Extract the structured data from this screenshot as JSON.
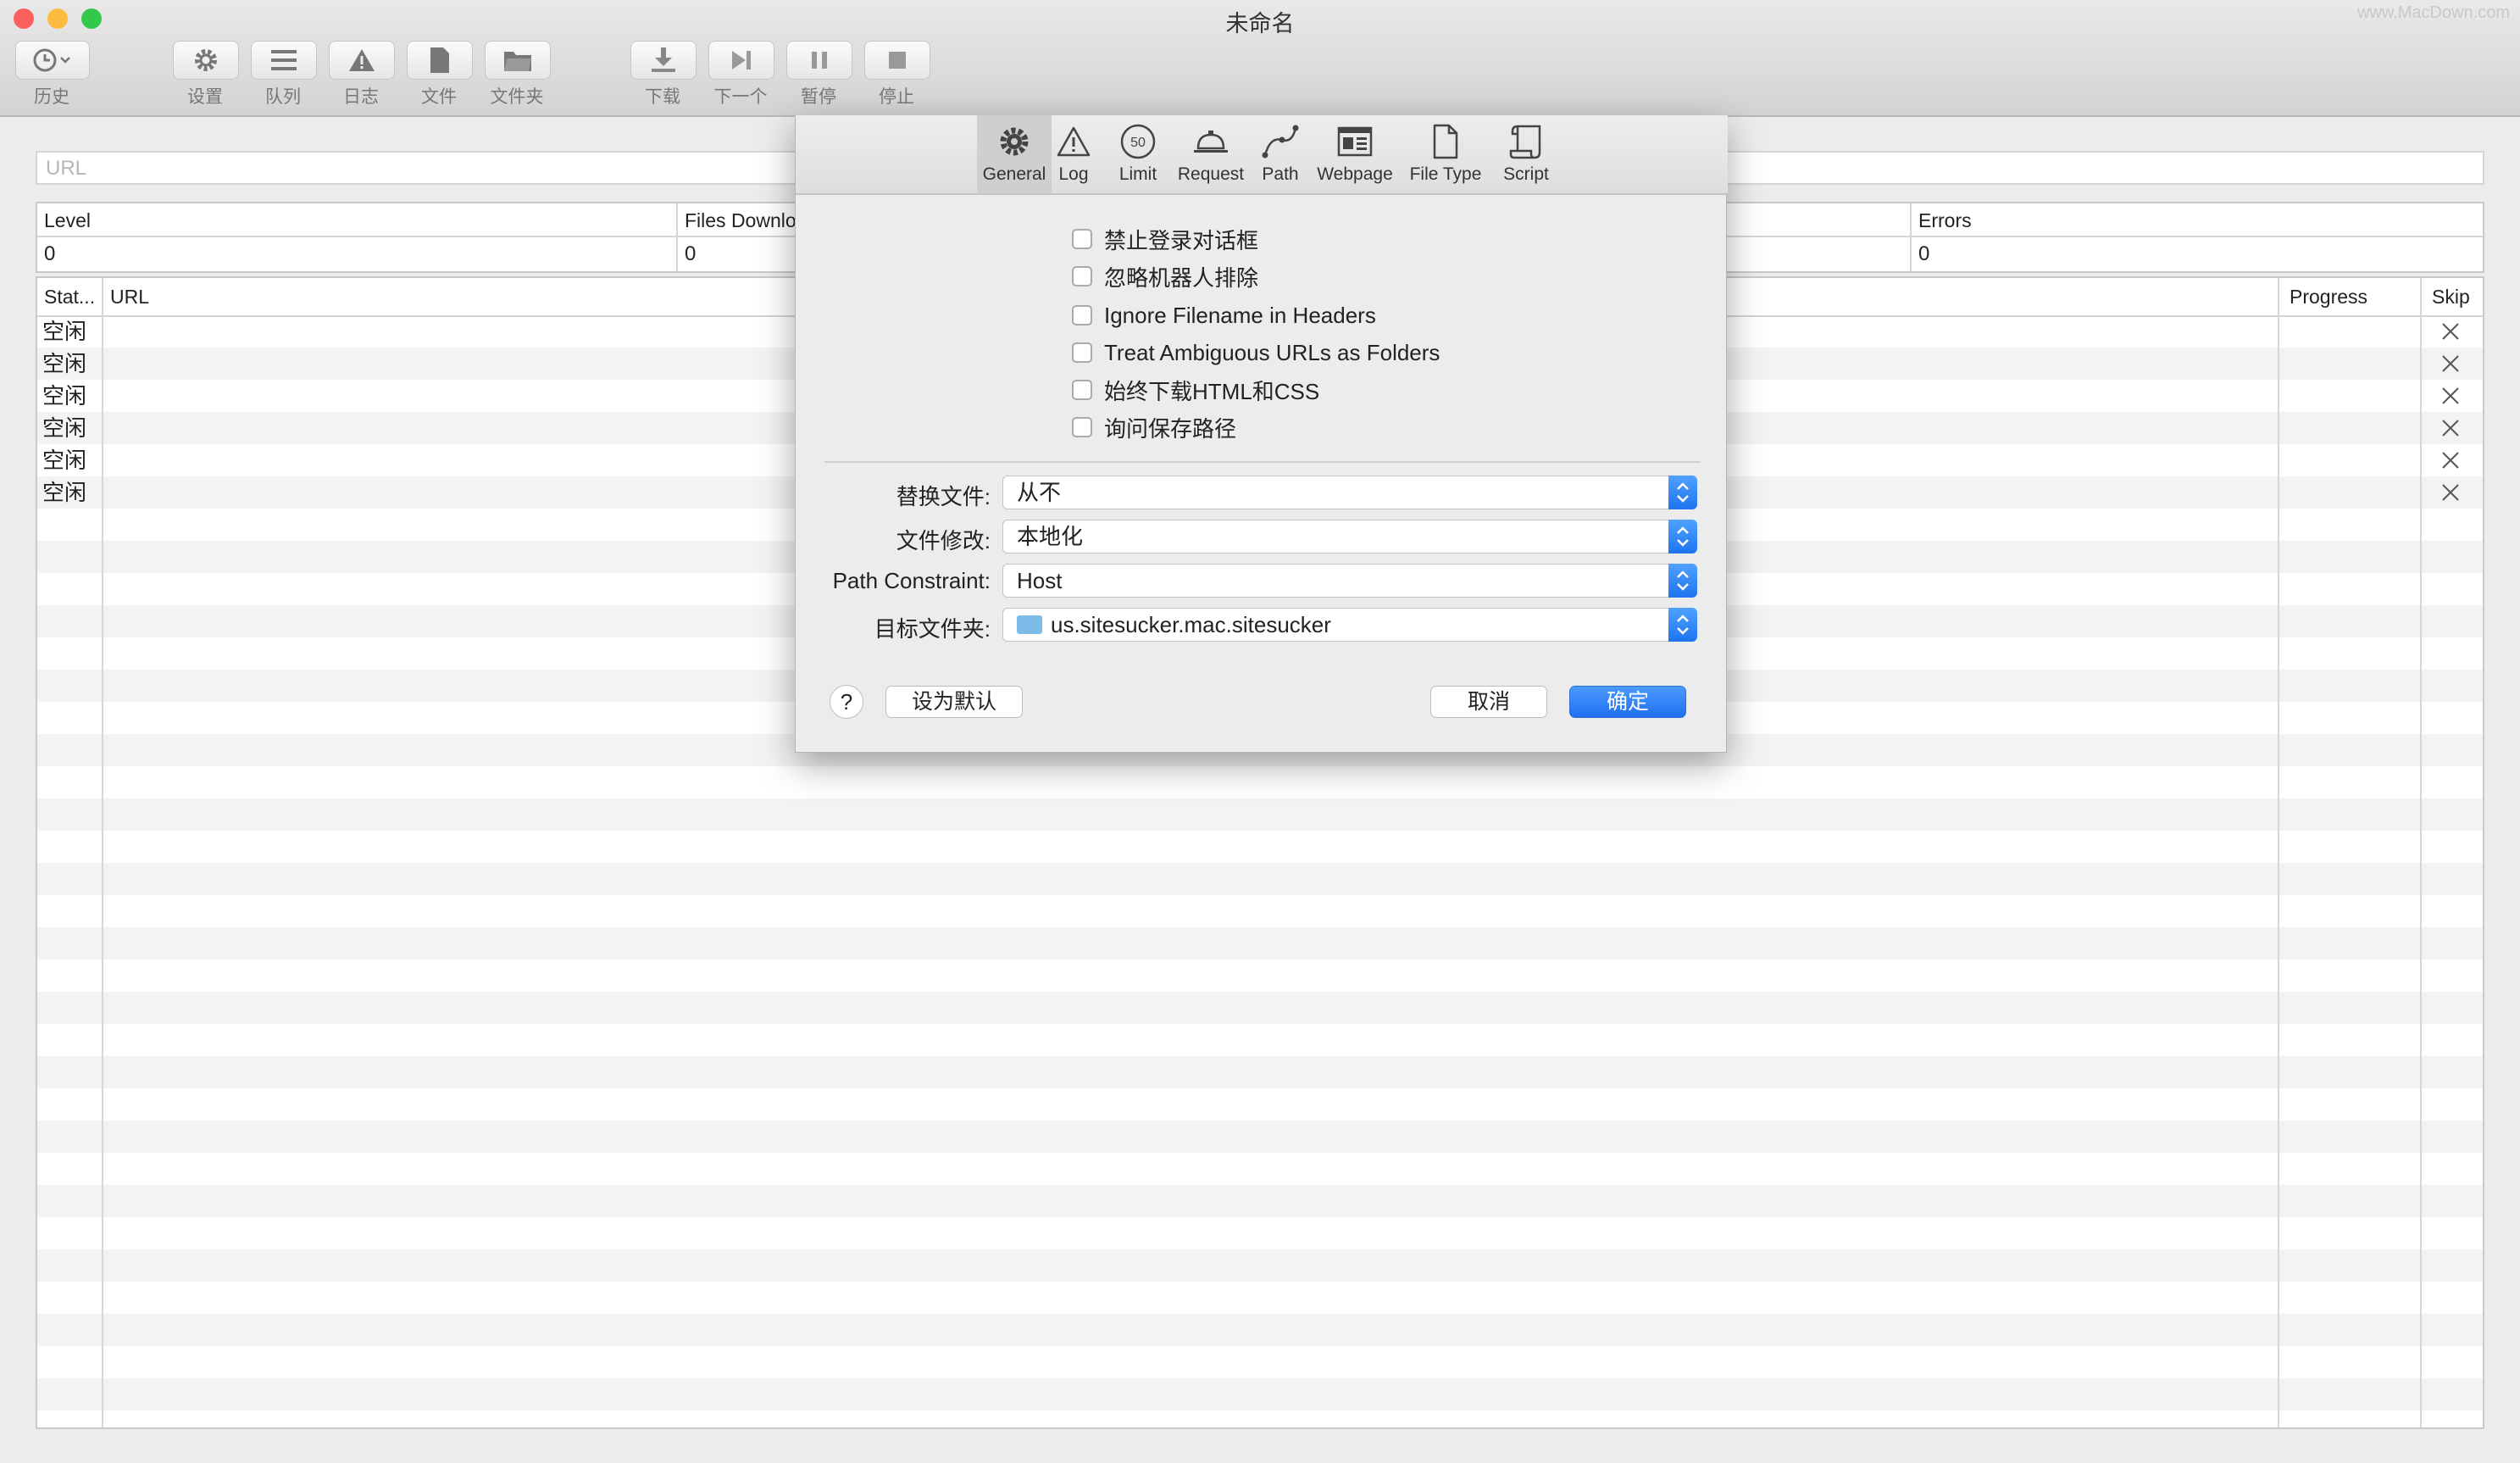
{
  "window": {
    "title": "未命名",
    "watermark": "www.MacDown.com"
  },
  "toolbar": {
    "history": "历史",
    "settings": "设置",
    "queue": "队列",
    "log": "日志",
    "file": "文件",
    "folder": "文件夹",
    "download": "下载",
    "next": "下一个",
    "pause": "暂停",
    "stop": "停止"
  },
  "url_field": {
    "placeholder": "URL"
  },
  "stats": {
    "level_header": "Level",
    "files_downloaded_header": "Files Downlo",
    "errors_header": "Errors",
    "level_value": "0",
    "files_downloaded_value": "0",
    "errors_value": "0"
  },
  "queue": {
    "headers": {
      "status": "Stat...",
      "url": "URL",
      "progress": "Progress",
      "skip": "Skip"
    },
    "rows": [
      {
        "status": "空闲"
      },
      {
        "status": "空闲"
      },
      {
        "status": "空闲"
      },
      {
        "status": "空闲"
      },
      {
        "status": "空闲"
      },
      {
        "status": "空闲"
      }
    ]
  },
  "dialog": {
    "tabs": {
      "general": "General",
      "log": "Log",
      "limit": "Limit",
      "limit_badge": "50",
      "request": "Request",
      "path": "Path",
      "webpage": "Webpage",
      "file_type": "File Type",
      "script": "Script"
    },
    "checkboxes": {
      "c1": "禁止登录对话框",
      "c2": "忽略机器人排除",
      "c3": "Ignore Filename in Headers",
      "c4": "Treat Ambiguous URLs as Folders",
      "c5": "始终下载HTML和CSS",
      "c6": "询问保存路径"
    },
    "fields": {
      "replace_files_label": "替换文件:",
      "replace_files_value": "从不",
      "file_modification_label": "文件修改:",
      "file_modification_value": "本地化",
      "path_constraint_label": "Path Constraint:",
      "path_constraint_value": "Host",
      "destination_label": "目标文件夹:",
      "destination_value": "us.sitesucker.mac.sitesucker"
    },
    "buttons": {
      "help": "?",
      "set_default": "设为默认",
      "cancel": "取消",
      "ok": "确定"
    }
  },
  "colors": {
    "accent": "#1f6ff0",
    "close": "#fc605c",
    "minimize": "#fdbc40",
    "zoom": "#34c84a"
  }
}
